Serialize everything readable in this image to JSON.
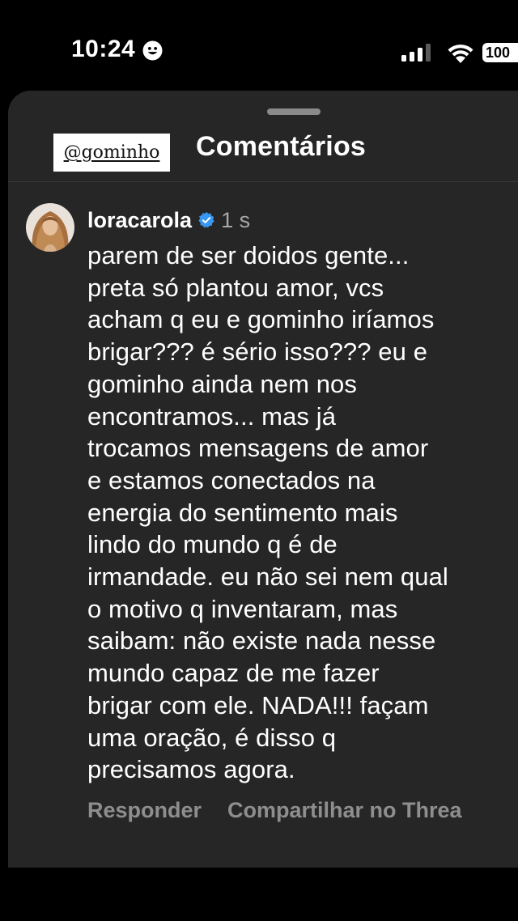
{
  "status_bar": {
    "time": "10:24",
    "battery": "100",
    "icons": [
      "smiley-icon",
      "signal-icon",
      "wifi-icon",
      "battery-icon"
    ]
  },
  "sheet": {
    "title": "Comentários",
    "sticker_username": "@gominho"
  },
  "comment": {
    "author": "loracarola",
    "verified": true,
    "time_ago": "1 s",
    "text": "parem de ser doidos gente...\npreta só plantou amor, vcs\nacham q eu e gominho iríamos\nbrigar??? é sério isso??? eu e\ngominho ainda nem nos\nencontramos... mas já\ntrocamos mensagens de amor\ne estamos conectados na\nenergia do sentimento mais\nlindo do mundo q é de\nirmandade. eu não sei nem qual\no motivo q inventaram, mas\nsaibam: não existe nada nesse\nmundo capaz de me fazer\nbrigar com ele. NADA!!! façam\numa oração, é disso q\nprecisamos agora.",
    "actions": {
      "reply": "Responder",
      "share": "Compartilhar no Threa"
    }
  },
  "colors": {
    "background": "#000000",
    "sheet": "#262626",
    "verified": "#3897f0",
    "muted_text": "#8e8e8e"
  }
}
